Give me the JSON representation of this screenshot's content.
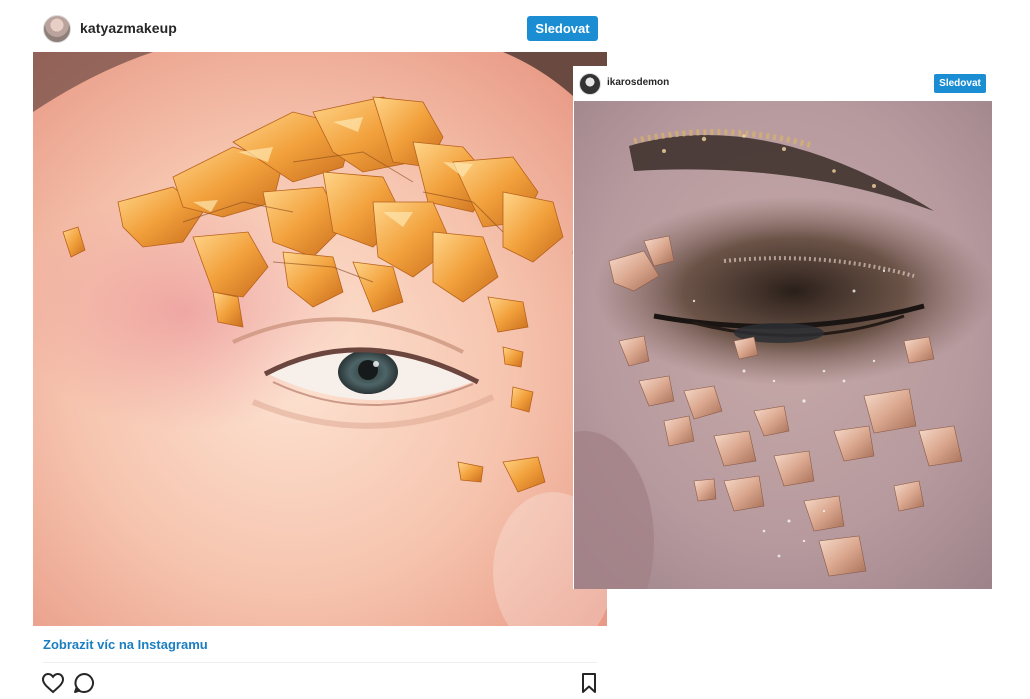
{
  "post1": {
    "username": "katyazmakeup",
    "follow_label": "Sledovat",
    "view_more_label": "Zobrazit víc na Instagramu",
    "photo": "close-up of eye with orange gold leaf on brow",
    "icons": [
      "heart-icon",
      "comment-icon",
      "bookmark-icon"
    ]
  },
  "post2": {
    "username": "ikarosdemon",
    "follow_label": "Sledovat",
    "photo": "close-up of closed eye with smoky shadow and rose gold flakes"
  },
  "colors": {
    "follow_button": "#1b8ed3",
    "link": "#1a7ec1",
    "text": "#262626"
  }
}
